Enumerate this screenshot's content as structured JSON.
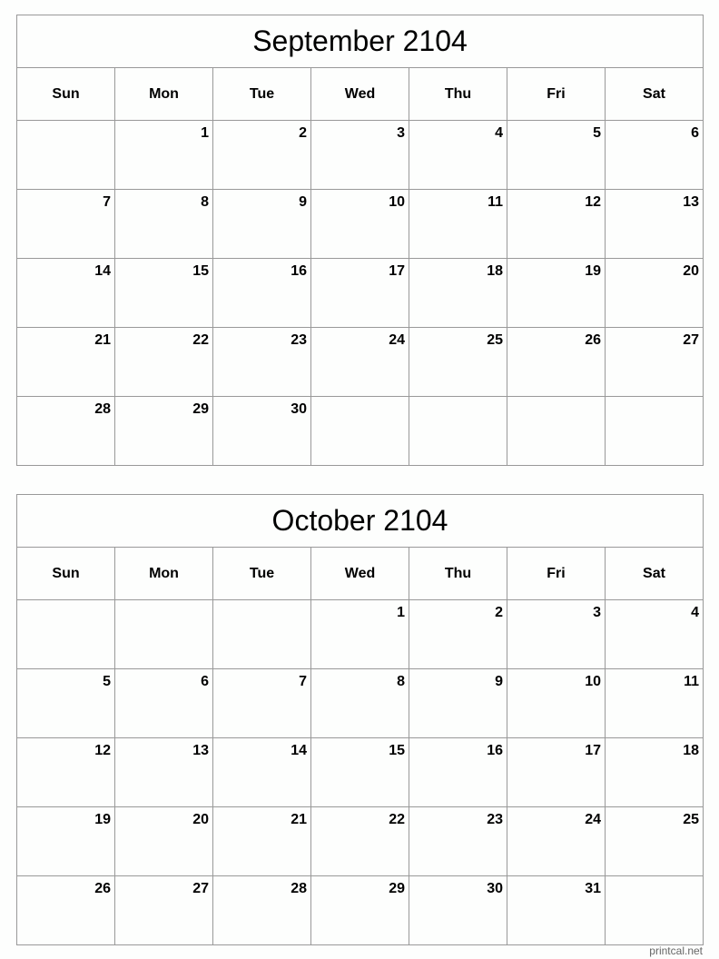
{
  "calendars": [
    {
      "title": "September 2104",
      "weekdays": [
        "Sun",
        "Mon",
        "Tue",
        "Wed",
        "Thu",
        "Fri",
        "Sat"
      ],
      "weeks": [
        [
          "",
          "1",
          "2",
          "3",
          "4",
          "5",
          "6"
        ],
        [
          "7",
          "8",
          "9",
          "10",
          "11",
          "12",
          "13"
        ],
        [
          "14",
          "15",
          "16",
          "17",
          "18",
          "19",
          "20"
        ],
        [
          "21",
          "22",
          "23",
          "24",
          "25",
          "26",
          "27"
        ],
        [
          "28",
          "29",
          "30",
          "",
          "",
          "",
          ""
        ]
      ]
    },
    {
      "title": "October 2104",
      "weekdays": [
        "Sun",
        "Mon",
        "Tue",
        "Wed",
        "Thu",
        "Fri",
        "Sat"
      ],
      "weeks": [
        [
          "",
          "",
          "",
          "1",
          "2",
          "3",
          "4"
        ],
        [
          "5",
          "6",
          "7",
          "8",
          "9",
          "10",
          "11"
        ],
        [
          "12",
          "13",
          "14",
          "15",
          "16",
          "17",
          "18"
        ],
        [
          "19",
          "20",
          "21",
          "22",
          "23",
          "24",
          "25"
        ],
        [
          "26",
          "27",
          "28",
          "29",
          "30",
          "31",
          ""
        ]
      ]
    }
  ],
  "footer": {
    "credit": "printcal.net"
  }
}
